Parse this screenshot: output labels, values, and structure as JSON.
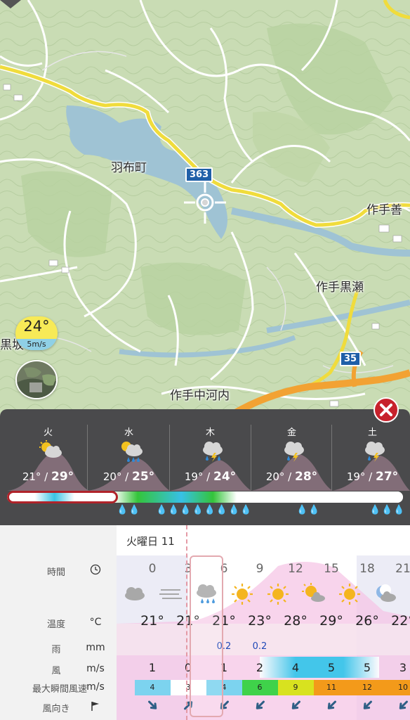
{
  "map": {
    "labels": {
      "habu": "羽布町",
      "sakute_zen": "作手善",
      "sakute_kurose": "作手黒瀬",
      "sakute_nakakouchi": "作手中河内",
      "kurosaka": "黒坂"
    },
    "route_363": "363",
    "route_35": "35",
    "current_temp": "24°",
    "current_wind": "5m/s",
    "crosshair_icon": "crosshair-icon",
    "colors": {
      "land": "#c9dcb4",
      "water": "#9fc3d4",
      "highway": "#f0dc3c",
      "road": "#ffffff",
      "arterial": "#f2a233"
    }
  },
  "week": {
    "days": [
      {
        "name": "火",
        "low": "21°",
        "high": "29°",
        "icon": "partly-cloudy-icon"
      },
      {
        "name": "水",
        "low": "20°",
        "high": "25°",
        "icon": "sun-cloud-rain-icon"
      },
      {
        "name": "木",
        "low": "19°",
        "high": "24°",
        "icon": "cloud-thunder-rain-icon"
      },
      {
        "name": "金",
        "low": "20°",
        "high": "28°",
        "icon": "cloud-thunder-rain-icon"
      },
      {
        "name": "土",
        "low": "19°",
        "high": "27°",
        "icon": "cloud-thunder-rain-icon"
      }
    ],
    "sep": " / ",
    "close_icon": "close-icon"
  },
  "hourly": {
    "day_title": "火曜日 11",
    "labels": {
      "time": "時間",
      "temp": "温度",
      "rain": "雨",
      "wind": "風",
      "gust": "最大瞬間風速",
      "direction": "風向き"
    },
    "units": {
      "temp": "°C",
      "rain": "mm",
      "wind": "m/s",
      "gust": "m/s"
    },
    "hours": [
      {
        "hour": "0",
        "icon": "cloud-icon",
        "temp": "21°",
        "rain": "",
        "wind": "1",
        "gust": "4",
        "gust_color": "#7cd3ef"
      },
      {
        "hour": "3",
        "icon": "fog-icon",
        "temp": "21°",
        "rain": "",
        "wind": "0",
        "gust": "3",
        "gust_color": "#ffffff"
      },
      {
        "hour": "6",
        "icon": "cloud-rain-icon",
        "temp": "21°",
        "rain": "0.2",
        "wind": "1",
        "gust": "4",
        "gust_color": "#7cd3ef"
      },
      {
        "hour": "9",
        "icon": "sun-icon",
        "temp": "23°",
        "rain": "0.2",
        "wind": "2",
        "gust": "6",
        "gust_color": "#3fd24a"
      },
      {
        "hour": "12",
        "icon": "sun-icon",
        "temp": "28°",
        "rain": "",
        "wind": "4",
        "gust": "9",
        "gust_color": "#d8e21f"
      },
      {
        "hour": "15",
        "icon": "sun-cloud-icon",
        "temp": "29°",
        "rain": "",
        "wind": "5",
        "gust": "11",
        "gust_color": "#f39a1a"
      },
      {
        "hour": "18",
        "icon": "sun-icon",
        "temp": "26°",
        "rain": "",
        "wind": "5",
        "gust": "12",
        "gust_color": "#f39a1a"
      },
      {
        "hour": "21",
        "icon": "moon-cloud-icon",
        "temp": "22°",
        "rain": "",
        "wind": "3",
        "gust": "10",
        "gust_color": "#f39a1a"
      }
    ],
    "wind_dir_icon": "wind-arrow-icon"
  }
}
